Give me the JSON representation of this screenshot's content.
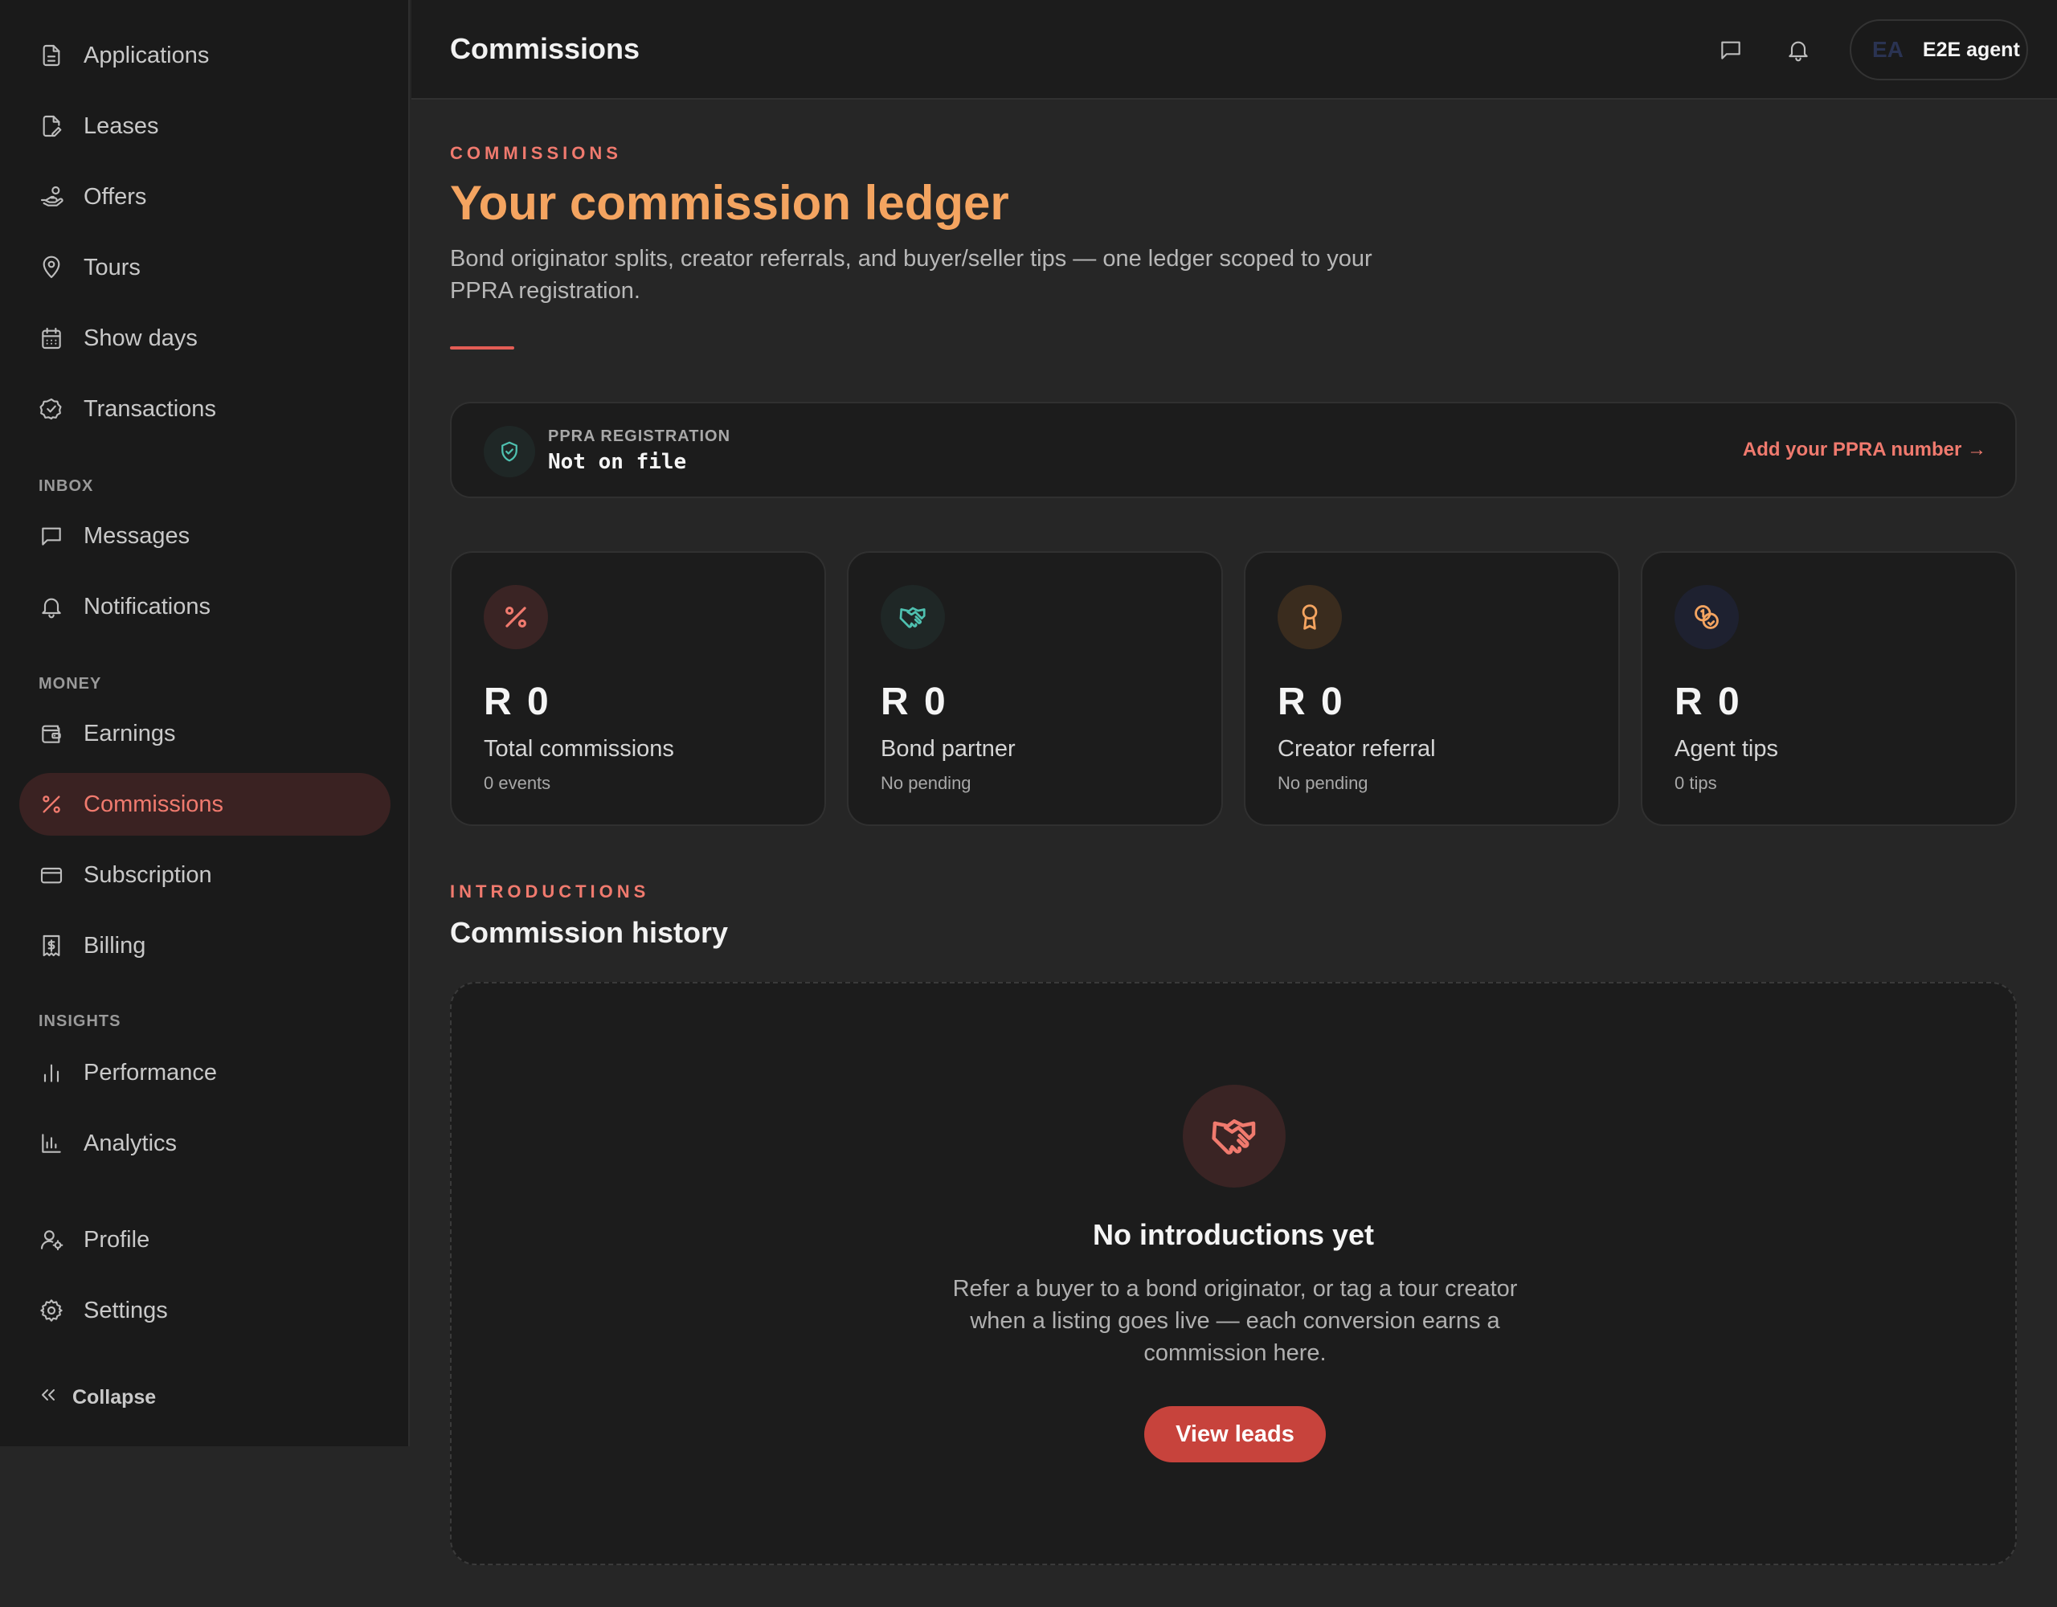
{
  "sidebar": {
    "items": [
      {
        "label": "Applications",
        "icon": "file-text-icon"
      },
      {
        "label": "Leases",
        "icon": "file-edit-icon"
      },
      {
        "label": "Offers",
        "icon": "hand-coins-icon"
      },
      {
        "label": "Tours",
        "icon": "map-pin-icon"
      },
      {
        "label": "Show days",
        "icon": "calendar-icon"
      },
      {
        "label": "Transactions",
        "icon": "check-circle-icon"
      }
    ],
    "inbox_label": "INBOX",
    "inbox_items": [
      {
        "label": "Messages",
        "icon": "message-square-icon"
      },
      {
        "label": "Notifications",
        "icon": "bell-icon"
      }
    ],
    "money_label": "MONEY",
    "money_items": [
      {
        "label": "Earnings",
        "icon": "wallet-icon"
      },
      {
        "label": "Commissions",
        "icon": "percent-icon",
        "active": true
      },
      {
        "label": "Subscription",
        "icon": "credit-card-icon"
      },
      {
        "label": "Billing",
        "icon": "receipt-icon"
      }
    ],
    "insights_label": "INSIGHTS",
    "insights_items": [
      {
        "label": "Performance",
        "icon": "bar-chart-icon"
      },
      {
        "label": "Analytics",
        "icon": "bar-chart-axis-icon"
      }
    ],
    "account_items": [
      {
        "label": "Profile",
        "icon": "user-cog-icon"
      },
      {
        "label": "Settings",
        "icon": "gear-icon"
      }
    ],
    "collapse_label": "Collapse"
  },
  "header": {
    "title": "Commissions",
    "user_initials": "EA",
    "user_name": "E2E agent"
  },
  "hero": {
    "eyebrow": "COMMISSIONS",
    "title": "Your commission ledger",
    "subtitle": "Bond originator splits, creator referrals, and buyer/seller tips — one ledger scoped to your PPRA registration."
  },
  "ppra": {
    "label": "PPRA REGISTRATION",
    "value": "Not on file",
    "action": "Add your PPRA number →"
  },
  "cards": [
    {
      "amount": "R 0",
      "label": "Total commissions",
      "meta": "0 events",
      "icon": "percent-icon",
      "color": "#f07a6e",
      "bg": "#3a2424"
    },
    {
      "amount": "R 0",
      "label": "Bond partner",
      "meta": "No pending",
      "icon": "handshake-icon",
      "color": "#4fc1b0",
      "bg": "#1f2726"
    },
    {
      "amount": "R 0",
      "label": "Creator referral",
      "meta": "No pending",
      "icon": "award-icon",
      "color": "#f4a460",
      "bg": "#3a2c1e"
    },
    {
      "amount": "R 0",
      "label": "Agent tips",
      "meta": "0 tips",
      "icon": "coins-icon",
      "color": "#f4a460",
      "bg": "#1e2130"
    }
  ],
  "history": {
    "eyebrow": "INTRODUCTIONS",
    "title": "Commission history",
    "empty_title": "No introductions yet",
    "empty_text": "Refer a buyer to a bond originator, or tag a tour creator when a listing goes live — each conversion earns a commission here.",
    "button": "View leads"
  },
  "colors": {
    "accent": "#f07a6e",
    "hero_title": "#f4a460",
    "button": "#c7433c"
  }
}
